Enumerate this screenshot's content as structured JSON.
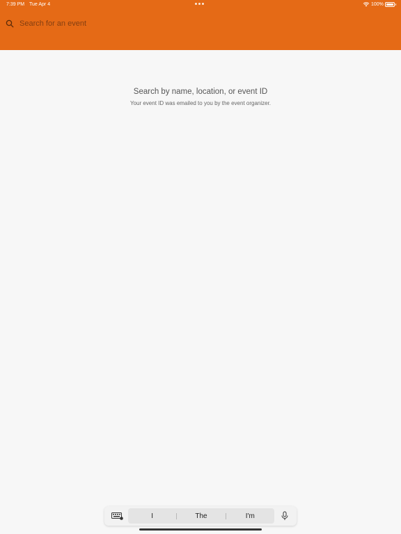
{
  "status_bar": {
    "time": "7:39 PM",
    "date": "Tue Apr 4",
    "battery": "100%"
  },
  "search": {
    "placeholder": "Search for an event"
  },
  "empty_state": {
    "title": "Search by name, location, or event ID",
    "subtitle": "Your event ID was emailed to you by the event organizer."
  },
  "keyboard_bar": {
    "suggestions": [
      "I",
      "The",
      "I'm"
    ]
  },
  "colors": {
    "header": "#e56a16",
    "background": "#f7f7f7"
  },
  "icons": [
    "search-icon",
    "wifi-icon",
    "battery-icon",
    "keyboard-icon",
    "microphone-icon"
  ]
}
